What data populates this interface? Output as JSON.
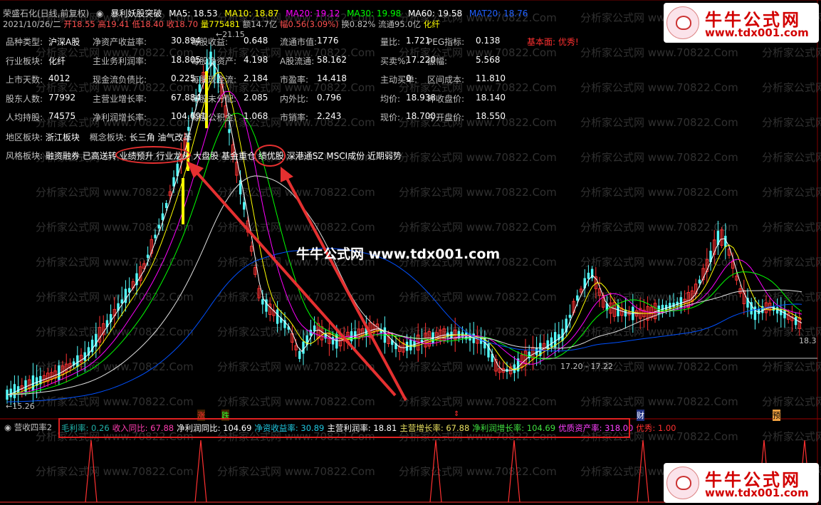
{
  "header": {
    "stock_name": "荣盛石化(日线,前复权)",
    "indicator_name": "暴利妖股突破",
    "ma5": "MA5: 18.53",
    "ma10": "MA10: 18.87",
    "ma20": "MA20: 19.12",
    "ma30": "MA30: 19.98",
    "ma60": "MA60: 19.58",
    "mat20": "MAT20: 18.76"
  },
  "quote_line": {
    "date": "2021/10/26/二",
    "open": "开18.55",
    "high": "高19.41",
    "low": "低18.40",
    "close": "收18.70",
    "volume": "量775481",
    "amount": "额14.7亿",
    "range": "幅0.56(3.09%)",
    "turnover": "换0.82%",
    "float": "流通95.0亿",
    "industry": "化纤"
  },
  "fundamentals": [
    [
      {
        "l": "品种类型:",
        "v": "沪深A股"
      },
      {
        "l": "净资产收益率:",
        "v": "30.894"
      },
      {
        "l": "每股收益:",
        "v": "0.648"
      },
      {
        "l": "流通市值:",
        "v": "1776"
      },
      {
        "l": "量比:",
        "v": "1.721"
      },
      {
        "l": "PEG指标:",
        "v": "0.138"
      }
    ],
    [
      {
        "l": "行业板块:",
        "v": "化纤"
      },
      {
        "l": "主业务利润率:",
        "v": "18.805"
      },
      {
        "l": "每股净资产:",
        "v": "4.198"
      },
      {
        "l": "A股流通:",
        "v": "58.162"
      },
      {
        "l": "买卖%:",
        "v": "17.220"
      },
      {
        "l": "振幅:",
        "v": "5.568"
      }
    ],
    [
      {
        "l": "上市天数:",
        "v": "4012"
      },
      {
        "l": "现金流负债比:",
        "v": "0.225"
      },
      {
        "l": "每股现金流:",
        "v": "2.184"
      },
      {
        "l": "市盈率:",
        "v": "14.418"
      },
      {
        "l": "主动买单:",
        "v": "0"
      },
      {
        "l": "区间成本:",
        "v": "11.810"
      }
    ],
    [
      {
        "l": "股东人数:",
        "v": "77992"
      },
      {
        "l": "主营业增长率:",
        "v": "67.884"
      },
      {
        "l": "每股未分配:",
        "v": "2.085"
      },
      {
        "l": "内外比:",
        "v": "0.796"
      },
      {
        "l": "均价:",
        "v": "18.938"
      },
      {
        "l": "昨收盘价:",
        "v": "18.140"
      }
    ],
    [
      {
        "l": "人均持股:",
        "v": "74575"
      },
      {
        "l": "净利润增长率:",
        "v": "104.691"
      },
      {
        "l": "每股公积金:",
        "v": "1.068"
      },
      {
        "l": "市销率:",
        "v": "2.243"
      },
      {
        "l": "现价:",
        "v": "18.700"
      },
      {
        "l": "今开盘价:",
        "v": "18.550"
      }
    ]
  ],
  "basic_face": "基本面: 优秀!",
  "region": {
    "l": "地区板块:",
    "v": "浙江板块",
    "concept_l": "概念板块:",
    "concept_v": "长三角 油气改革"
  },
  "style": {
    "l": "风格板块:",
    "v": "融资融券 已高送转 业绩预升 行业龙头 大盘股 基金重仓 绩优股 深港通SZ MSCI成份 近期弱势"
  },
  "price_labels": {
    "high": "21.15",
    "low": "15.26",
    "right": "18.3",
    "range": "17.20 - 17.22"
  },
  "watermark": "分析家公式网 www.70822.Com",
  "banner": "牛牛公式网 www.tdx001.com",
  "logo": {
    "title": "牛牛公式网",
    "url": "www.tdx001.com"
  },
  "markers": {
    "zhang": "涨",
    "die": "跌",
    "cai": "财",
    "yu": "预"
  },
  "indicator": {
    "name": "营收四率2",
    "items": [
      {
        "l": "毛利率:",
        "v": "0.26",
        "c": "#20b2aa"
      },
      {
        "l": "收入同比:",
        "v": "67.88",
        "c": "#ff3db0"
      },
      {
        "l": "净利润同比:",
        "v": "104.69",
        "c": "#ffffff"
      },
      {
        "l": "净资收益率:",
        "v": "30.89",
        "c": "#20c8e0"
      },
      {
        "l": "主营利润率:",
        "v": "18.81",
        "c": "#ffffff"
      },
      {
        "l": "主营增长率:",
        "v": "67.88",
        "c": "#e8e060"
      },
      {
        "l": "净利润增长率:",
        "v": "104.69",
        "c": "#40e040"
      },
      {
        "l": "优质资产率:",
        "v": "318.00",
        "c": "#ff40ff"
      },
      {
        "l": "优秀:",
        "v": "1.00",
        "c": "#ff3030"
      }
    ]
  },
  "colors": {
    "up": "#ff3232",
    "down": "#54ffff",
    "ma5": "#ffffff",
    "ma10": "#ffff00",
    "ma20": "#ff00ff",
    "ma30": "#00ff00",
    "ma60": "#ffffff",
    "mat20": "#0050ff"
  }
}
